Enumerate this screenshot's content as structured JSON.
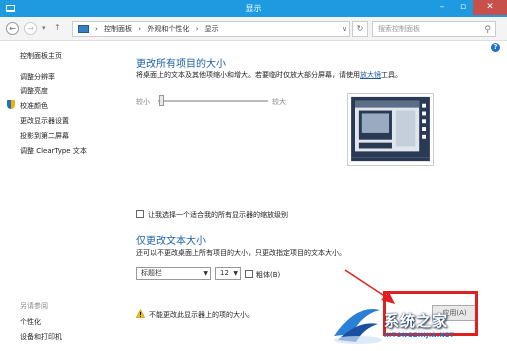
{
  "window": {
    "title": "显示",
    "min": "–",
    "max": "▫",
    "close": "✕"
  },
  "address": {
    "crumbs": [
      "控制面板",
      "外观和个性化",
      "显示"
    ],
    "search_placeholder": "搜索控制面板"
  },
  "sidebar": {
    "home": "控制面板主页",
    "items": [
      "调整分辨率",
      "调整亮度",
      "校准颜色",
      "更改显示器设置",
      "投影到第二屏幕",
      "调整 ClearType 文本"
    ],
    "see_also": "另请参阅",
    "links": [
      "个性化",
      "设备和打印机"
    ]
  },
  "main": {
    "heading1": "更改所有项目的大小",
    "desc1_pre": "将桌面上的文本及其他项缩小和增大。若要临时仅放大部分屏幕，请使用",
    "desc1_link": "放大镜",
    "desc1_post": "工具。",
    "slider_small": "较小",
    "slider_large": "较大",
    "checkbox_scale": "让我选择一个适合我的所有显示器的缩放级别",
    "heading2": "仅更改文本大小",
    "desc2": "还可以不更改桌面上所有项目的大小，只更改指定项目的文本大小。",
    "item_select": "标题栏",
    "size_select": "12",
    "bold_label": "粗体(B)",
    "warning": "不能更改此显示器上的项的大小。",
    "apply": "应用(A)"
  },
  "colors": {
    "titlebar": "#1e9be0",
    "link": "#1b5fa8",
    "highlight": "#e02020"
  },
  "watermark": {
    "title": "系统之家",
    "url": "XITONGZHIJIA.NET"
  }
}
